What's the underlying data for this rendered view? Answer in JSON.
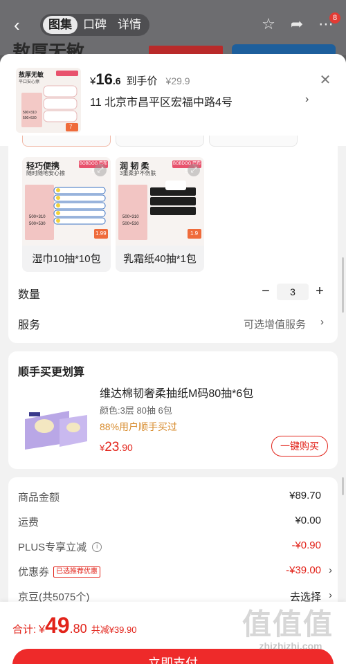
{
  "nav": {
    "tabs": [
      "图集",
      "口碑",
      "详情"
    ],
    "badge_count": "8",
    "bg_title": "敖厚无敏"
  },
  "header": {
    "yen": "¥",
    "price_int": "16",
    "price_dec": ".6",
    "price_label": "到手价",
    "original_price": "¥29.9",
    "address": "11  北京市昌平区宏福中路4号",
    "thumb_title": "敖厚无敏",
    "thumb_sub": "平口安心擦",
    "thumb_spec_1": "500×310",
    "thumb_spec_2": "500×530",
    "thumb_badge": "7"
  },
  "options": [
    {
      "label": "湿巾10抽*10包",
      "img_title": "轻巧便携",
      "img_sub": "随时随地安心擦",
      "img_brand": "BOBDOG 巴布豆",
      "spec_1": "500×310",
      "spec_2": "500×530",
      "badge": "1.99"
    },
    {
      "label": "乳霜纸40抽*1包",
      "img_title": "润 韧 柔",
      "img_sub": "3重柔护不伤肤",
      "img_brand": "BOBDOG 巴布豆",
      "spec_1": "500×310",
      "spec_2": "500×530",
      "badge": "1.9"
    }
  ],
  "quantity": {
    "label": "数量",
    "value": "3",
    "minus": "−",
    "plus": "+"
  },
  "service": {
    "label": "服务",
    "value": "可选增值服务"
  },
  "addon": {
    "title": "顺手买更划算",
    "name": "维达棉韧奢柔抽纸M码80抽*6包",
    "spec": "颜色:3层 80抽 6包",
    "buyers": "88%用户顺手买过",
    "price_symbol": "¥",
    "price_int": "23",
    "price_dec": ".90",
    "buy_button": "一键购买"
  },
  "totals": {
    "goods_label": "商品金额",
    "goods_value": "¥89.70",
    "shipping_label": "运费",
    "shipping_value": "¥0.00",
    "plus_label": "PLUS专享立减",
    "plus_value": "-¥0.90",
    "coupon_label": "优惠券",
    "coupon_tag": "已选推荐优惠",
    "coupon_value": "-¥39.00",
    "beans_label": "京豆(共5075个)",
    "beans_value": "去选择"
  },
  "bottom": {
    "total_label": "合计:",
    "yen": "¥",
    "total_int": "49",
    "total_dec": ".80",
    "saved": "共减¥39.90",
    "pay_button": "立即支付"
  },
  "watermark": {
    "big": "值值值",
    "small": "zhizhizhi.com"
  },
  "colors": {
    "accent_red": "#e2231a",
    "buyers_orange": "#d78a2b",
    "pay_button": "#ee2a2a"
  }
}
